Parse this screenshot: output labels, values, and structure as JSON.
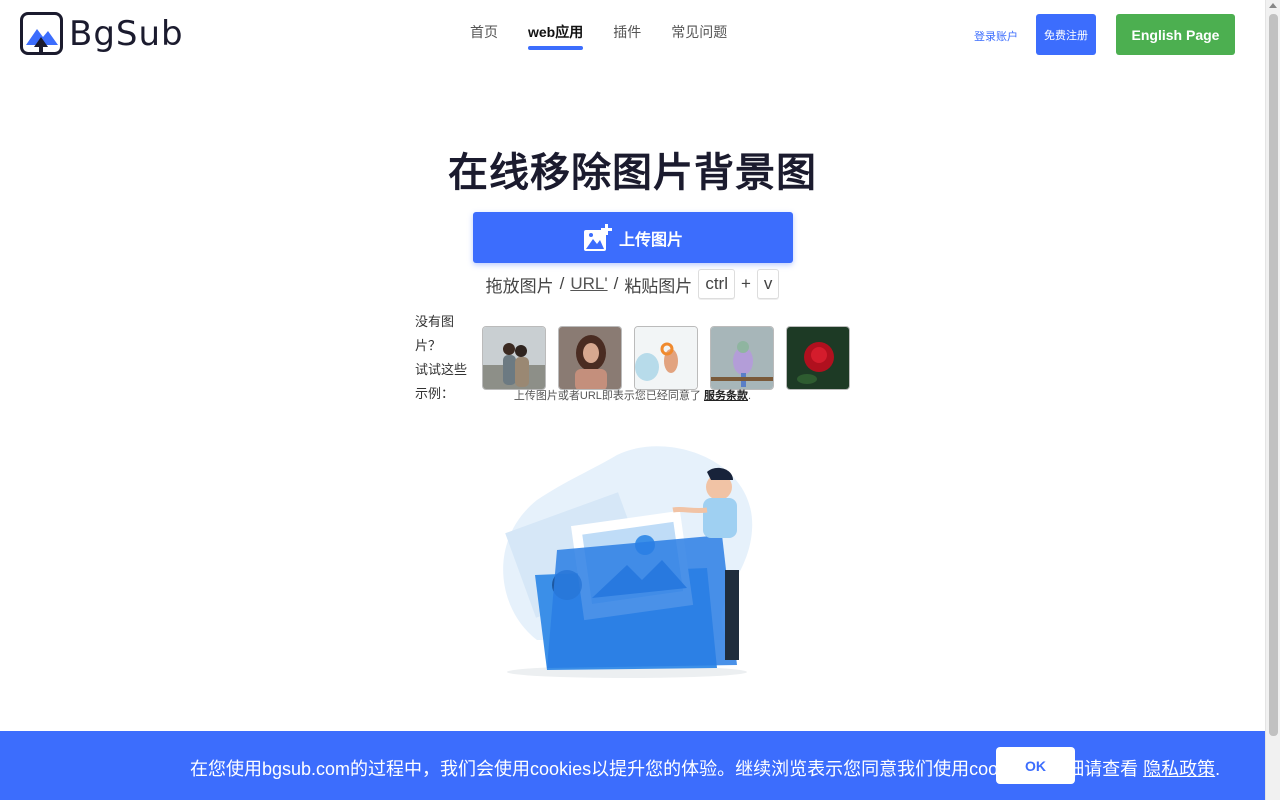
{
  "header": {
    "logo_text": "BgSub",
    "nav": [
      {
        "label": "首页",
        "active": false
      },
      {
        "label": "web应用",
        "active": true
      },
      {
        "label": "插件",
        "active": false
      },
      {
        "label": "常见问题",
        "active": false
      }
    ],
    "login_link": "登录账户",
    "signup_button": "免费注册",
    "english_button": "English Page"
  },
  "main": {
    "title": "在线移除图片背景图",
    "upload_button": "上传图片",
    "hint": {
      "drag_text": "拖放图片",
      "sep1": "/",
      "url_text": "URL'",
      "sep2": "/",
      "paste_text": "粘贴图片",
      "key1": "ctrl",
      "plus": "+",
      "key2": "v"
    },
    "samples_label_line1": "没有图片？",
    "samples_label_line2": "试试这些示例：",
    "samples": [
      {
        "name": "couple-on-beach"
      },
      {
        "name": "woman-portrait"
      },
      {
        "name": "hand-with-ring"
      },
      {
        "name": "lilac-breasted-roller-bird"
      },
      {
        "name": "red-rose"
      }
    ],
    "terms_text": "上传图片或者URL即表示您已经同意了",
    "terms_link": "服务条款",
    "terms_end": "."
  },
  "cookie": {
    "text": "在您使用bgsub.com的过程中，我们会使用cookies以提升您的体验。继续浏览表示您同意我们使用cookies，详细请查看",
    "link": "隐私政策",
    "end": ".",
    "ok": "OK"
  },
  "colors": {
    "primary": "#3c6dfd",
    "green": "#4caf50",
    "dark": "#1b1b2e"
  }
}
